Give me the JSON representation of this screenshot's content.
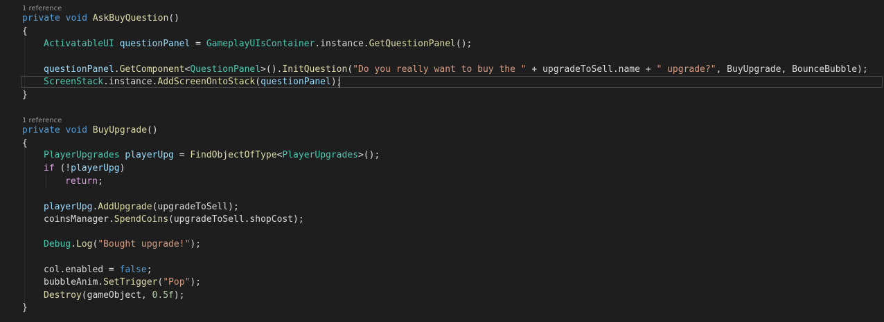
{
  "editor": {
    "methods": [
      {
        "reference": "1 reference",
        "signature": {
          "mod": "private",
          "ret": "void",
          "name": "AskBuyQuestion",
          "args": "()"
        }
      },
      {
        "reference": "1 reference",
        "signature": {
          "mod": "private",
          "ret": "void",
          "name": "BuyUpgrade",
          "args": "()"
        }
      }
    ],
    "braces": {
      "open": "{",
      "close": "}"
    },
    "lines": {
      "l1": {
        "type": "ActivatableUI",
        "var": "questionPanel",
        "eq": " = ",
        "cls": "GameplayUIsContainer",
        "mid": ".instance.",
        "method": "GetQuestionPanel",
        "end": "();"
      },
      "l2": {
        "var": "questionPanel",
        "dot": ".",
        "method": "GetComponent",
        "lt": "<",
        "generic": "QuestionPanel",
        "gt": ">().",
        "method2": "InitQuestion",
        "open": "(",
        "str1": "\"Do you really want to buy the \"",
        "plus1": " + upgradeToSell.name + ",
        "str2": "\" upgrade?\"",
        "rest": ", BuyUpgrade, BounceBubble);"
      },
      "l3": {
        "cls": "ScreenStack",
        "mid": ".instance.",
        "method": "AddScreenOntoStack",
        "open": "(",
        "arg": "questionPanel",
        "end": ");"
      },
      "l4": {
        "type": "PlayerUpgrades",
        "sp": " ",
        "var": "playerUpg",
        "eq": " = ",
        "method": "FindObjectOfType",
        "lt": "<",
        "generic": "PlayerUpgrades",
        "end": ">();"
      },
      "l5": {
        "kw": "if",
        "open": " (!",
        "var": "playerUpg",
        "close": ")"
      },
      "l6": {
        "kw": "return",
        "end": ";"
      },
      "l7": {
        "var": "playerUpg",
        "dot": ".",
        "method": "AddUpgrade",
        "rest": "(upgradeToSell);"
      },
      "l8": {
        "obj": "coinsManager",
        "dot": ".",
        "method": "SpendCoins",
        "rest": "(upgradeToSell.shopCost);"
      },
      "l9": {
        "cls": "Debug",
        "dot": ".",
        "method": "Log",
        "open": "(",
        "str": "\"Bought upgrade!\"",
        "end": ");"
      },
      "l10": {
        "obj": "col.enabled = ",
        "kw": "false",
        "end": ";"
      },
      "l11": {
        "obj": "bubbleAnim",
        "dot": ".",
        "method": "SetTrigger",
        "open": "(",
        "str": "\"Pop\"",
        "end": ");"
      },
      "l12": {
        "method": "Destroy",
        "rest": "(gameObject, ",
        "num": "0.5f",
        "end": ");"
      }
    }
  }
}
